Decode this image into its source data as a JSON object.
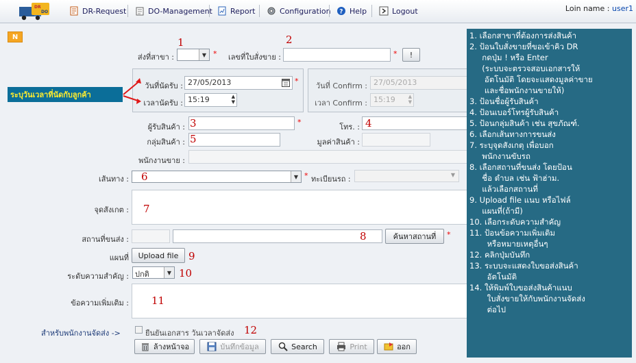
{
  "topbar": {
    "logo_text": "DR DO",
    "menu": [
      {
        "label": "DR-Request",
        "icon": "document-icon"
      },
      {
        "label": "DO-Management",
        "icon": "notepad-icon"
      },
      {
        "label": "Report",
        "icon": "report-icon"
      },
      {
        "label": "Configuration",
        "icon": "gear-icon"
      },
      {
        "label": "Help",
        "icon": "help-icon"
      },
      {
        "label": "Logout",
        "icon": "logout-icon"
      }
    ],
    "login_label": "Loin name :",
    "login_user": "user1"
  },
  "form": {
    "mode_badge": "N",
    "branch_label": "ส่งที่สาขา :",
    "branch_value": "",
    "so_label": "เลขที่ใบสั่งขาย :",
    "so_value": "",
    "so_button": "!",
    "appt_date_label": "วันที่นัดรับ :",
    "appt_date_value": "27/05/2013",
    "appt_time_label": "เวลานัดรับ :",
    "appt_time_value": "15:19",
    "confirm_date_label": "วันที่ Confirm :",
    "confirm_date_value": "27/05/2013",
    "confirm_time_label": "เวลา Confirm :",
    "confirm_time_value": "15:19",
    "receiver_label": "ผู้รับสินค้า :",
    "phone_label": "โทร. :",
    "product_group_label": "กลุ่มสินค้า :",
    "product_value_label": "มูลค่าสินค้า :",
    "salesperson_label": "พนักงานขาย :",
    "route_label": "เส้นทาง :",
    "plate_label": "ทะเบียนรถ :",
    "note_label": "จุดสังเกต :",
    "location_label": "สถานที่ขนส่ง :",
    "search_location_button": "ค้นหาสถานที่",
    "map_label": "แผนที่",
    "upload_button": "Upload file",
    "priority_label": "ระดับความสำคัญ :",
    "priority_value": "ปกติ",
    "extra_label": "ข้อความเพิ่มเติม :",
    "for_staff_label": "สำหรับพนักงานจัดส่ง ->",
    "confirm_doc_label": "ยืนยันเอกสาร วันเวลาจัดส่ง",
    "asterisk": "*"
  },
  "buttons": {
    "clear": "ล้างหน้าจอ",
    "save": "บันทึกข้อมูล",
    "search": "Search",
    "print": "Print",
    "exit": "ออก"
  },
  "annotations": {
    "n1": "1",
    "n2": "2",
    "n3": "3",
    "n4": "4",
    "n5": "5",
    "n6": "6",
    "n7": "7",
    "n8": "8",
    "n9": "9",
    "n10": "10",
    "n11": "11",
    "n12": "12",
    "callout": "ระบุวันเวลาที่นัดกับลูกค้า"
  },
  "help": [
    "1. เลือกสาขาที่ต้องการส่งสินค้า",
    "2. ป้อนใบสั่งขายที่ขอเข้าคิว DR",
    "     กดปุ่ม ! หรือ Enter",
    "     (ระบบจะตรวจสอบเอกสารให้",
    "      อัตโนมัติ โดยจะแสดงมูลค่าขาย",
    "      และชื่อพนักงานขายให้)",
    "3. ป้อนชื่อผู้รับสินค้า",
    "4. ป้อนเบอร์โทรผู้รับสินค้า",
    "5. ป้อนกลุ่มสินค้า เช่น สุขภัณฑ์.",
    "6. เลือกเส้นทางการขนส่ง",
    "7. ระบุจุดสังเกตุ เพื่อบอก",
    "     พนักงานขับรถ",
    "8. เลือกสถานที่ขนส่ง โดยป้อน",
    "     ชื่อ ตำบล เช่น ฟ้าฮ่าม.",
    "     แล้วเลือกสถานที่",
    "9. Upload file แนบ หรือไฟล์",
    "     แผนที่(ถ้ามี)",
    "10. เลือกระดับความสำคัญ",
    "11. ป้อนข้อความเพิ่มเติม",
    "       หรือหมายเหตุอื่นๆ",
    "12. คลิกปุ่มบันทึก",
    "13. ระบบจะแสดงใบขอส่งสินค้า",
    "       อัตโนมัติ",
    "14. ให้พิมพ์ใบขอส่งสินค้าแนบ",
    "       ใบสั่งขายให้กับพนักงานจัดส่ง",
    "       ต่อไป"
  ],
  "colors": {
    "help_bg": "#266a84",
    "callout_bg": "#0b6e99",
    "callout_text": "#ffec2e",
    "annotation_red": "#c00000",
    "badge": "#f5a623"
  }
}
